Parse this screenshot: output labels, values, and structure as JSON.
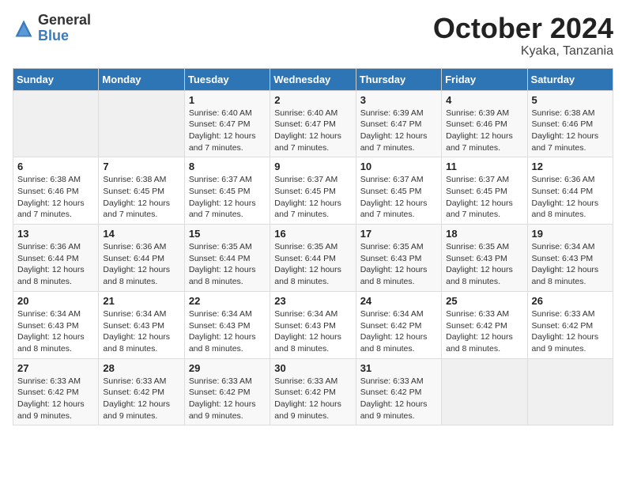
{
  "header": {
    "logo_general": "General",
    "logo_blue": "Blue",
    "month": "October 2024",
    "location": "Kyaka, Tanzania"
  },
  "weekdays": [
    "Sunday",
    "Monday",
    "Tuesday",
    "Wednesday",
    "Thursday",
    "Friday",
    "Saturday"
  ],
  "weeks": [
    [
      {
        "day": "",
        "info": ""
      },
      {
        "day": "",
        "info": ""
      },
      {
        "day": "1",
        "info": "Sunrise: 6:40 AM\nSunset: 6:47 PM\nDaylight: 12 hours and 7 minutes."
      },
      {
        "day": "2",
        "info": "Sunrise: 6:40 AM\nSunset: 6:47 PM\nDaylight: 12 hours and 7 minutes."
      },
      {
        "day": "3",
        "info": "Sunrise: 6:39 AM\nSunset: 6:47 PM\nDaylight: 12 hours and 7 minutes."
      },
      {
        "day": "4",
        "info": "Sunrise: 6:39 AM\nSunset: 6:46 PM\nDaylight: 12 hours and 7 minutes."
      },
      {
        "day": "5",
        "info": "Sunrise: 6:38 AM\nSunset: 6:46 PM\nDaylight: 12 hours and 7 minutes."
      }
    ],
    [
      {
        "day": "6",
        "info": "Sunrise: 6:38 AM\nSunset: 6:46 PM\nDaylight: 12 hours and 7 minutes."
      },
      {
        "day": "7",
        "info": "Sunrise: 6:38 AM\nSunset: 6:45 PM\nDaylight: 12 hours and 7 minutes."
      },
      {
        "day": "8",
        "info": "Sunrise: 6:37 AM\nSunset: 6:45 PM\nDaylight: 12 hours and 7 minutes."
      },
      {
        "day": "9",
        "info": "Sunrise: 6:37 AM\nSunset: 6:45 PM\nDaylight: 12 hours and 7 minutes."
      },
      {
        "day": "10",
        "info": "Sunrise: 6:37 AM\nSunset: 6:45 PM\nDaylight: 12 hours and 7 minutes."
      },
      {
        "day": "11",
        "info": "Sunrise: 6:37 AM\nSunset: 6:45 PM\nDaylight: 12 hours and 7 minutes."
      },
      {
        "day": "12",
        "info": "Sunrise: 6:36 AM\nSunset: 6:44 PM\nDaylight: 12 hours and 8 minutes."
      }
    ],
    [
      {
        "day": "13",
        "info": "Sunrise: 6:36 AM\nSunset: 6:44 PM\nDaylight: 12 hours and 8 minutes."
      },
      {
        "day": "14",
        "info": "Sunrise: 6:36 AM\nSunset: 6:44 PM\nDaylight: 12 hours and 8 minutes."
      },
      {
        "day": "15",
        "info": "Sunrise: 6:35 AM\nSunset: 6:44 PM\nDaylight: 12 hours and 8 minutes."
      },
      {
        "day": "16",
        "info": "Sunrise: 6:35 AM\nSunset: 6:44 PM\nDaylight: 12 hours and 8 minutes."
      },
      {
        "day": "17",
        "info": "Sunrise: 6:35 AM\nSunset: 6:43 PM\nDaylight: 12 hours and 8 minutes."
      },
      {
        "day": "18",
        "info": "Sunrise: 6:35 AM\nSunset: 6:43 PM\nDaylight: 12 hours and 8 minutes."
      },
      {
        "day": "19",
        "info": "Sunrise: 6:34 AM\nSunset: 6:43 PM\nDaylight: 12 hours and 8 minutes."
      }
    ],
    [
      {
        "day": "20",
        "info": "Sunrise: 6:34 AM\nSunset: 6:43 PM\nDaylight: 12 hours and 8 minutes."
      },
      {
        "day": "21",
        "info": "Sunrise: 6:34 AM\nSunset: 6:43 PM\nDaylight: 12 hours and 8 minutes."
      },
      {
        "day": "22",
        "info": "Sunrise: 6:34 AM\nSunset: 6:43 PM\nDaylight: 12 hours and 8 minutes."
      },
      {
        "day": "23",
        "info": "Sunrise: 6:34 AM\nSunset: 6:43 PM\nDaylight: 12 hours and 8 minutes."
      },
      {
        "day": "24",
        "info": "Sunrise: 6:34 AM\nSunset: 6:42 PM\nDaylight: 12 hours and 8 minutes."
      },
      {
        "day": "25",
        "info": "Sunrise: 6:33 AM\nSunset: 6:42 PM\nDaylight: 12 hours and 8 minutes."
      },
      {
        "day": "26",
        "info": "Sunrise: 6:33 AM\nSunset: 6:42 PM\nDaylight: 12 hours and 9 minutes."
      }
    ],
    [
      {
        "day": "27",
        "info": "Sunrise: 6:33 AM\nSunset: 6:42 PM\nDaylight: 12 hours and 9 minutes."
      },
      {
        "day": "28",
        "info": "Sunrise: 6:33 AM\nSunset: 6:42 PM\nDaylight: 12 hours and 9 minutes."
      },
      {
        "day": "29",
        "info": "Sunrise: 6:33 AM\nSunset: 6:42 PM\nDaylight: 12 hours and 9 minutes."
      },
      {
        "day": "30",
        "info": "Sunrise: 6:33 AM\nSunset: 6:42 PM\nDaylight: 12 hours and 9 minutes."
      },
      {
        "day": "31",
        "info": "Sunrise: 6:33 AM\nSunset: 6:42 PM\nDaylight: 12 hours and 9 minutes."
      },
      {
        "day": "",
        "info": ""
      },
      {
        "day": "",
        "info": ""
      }
    ]
  ]
}
